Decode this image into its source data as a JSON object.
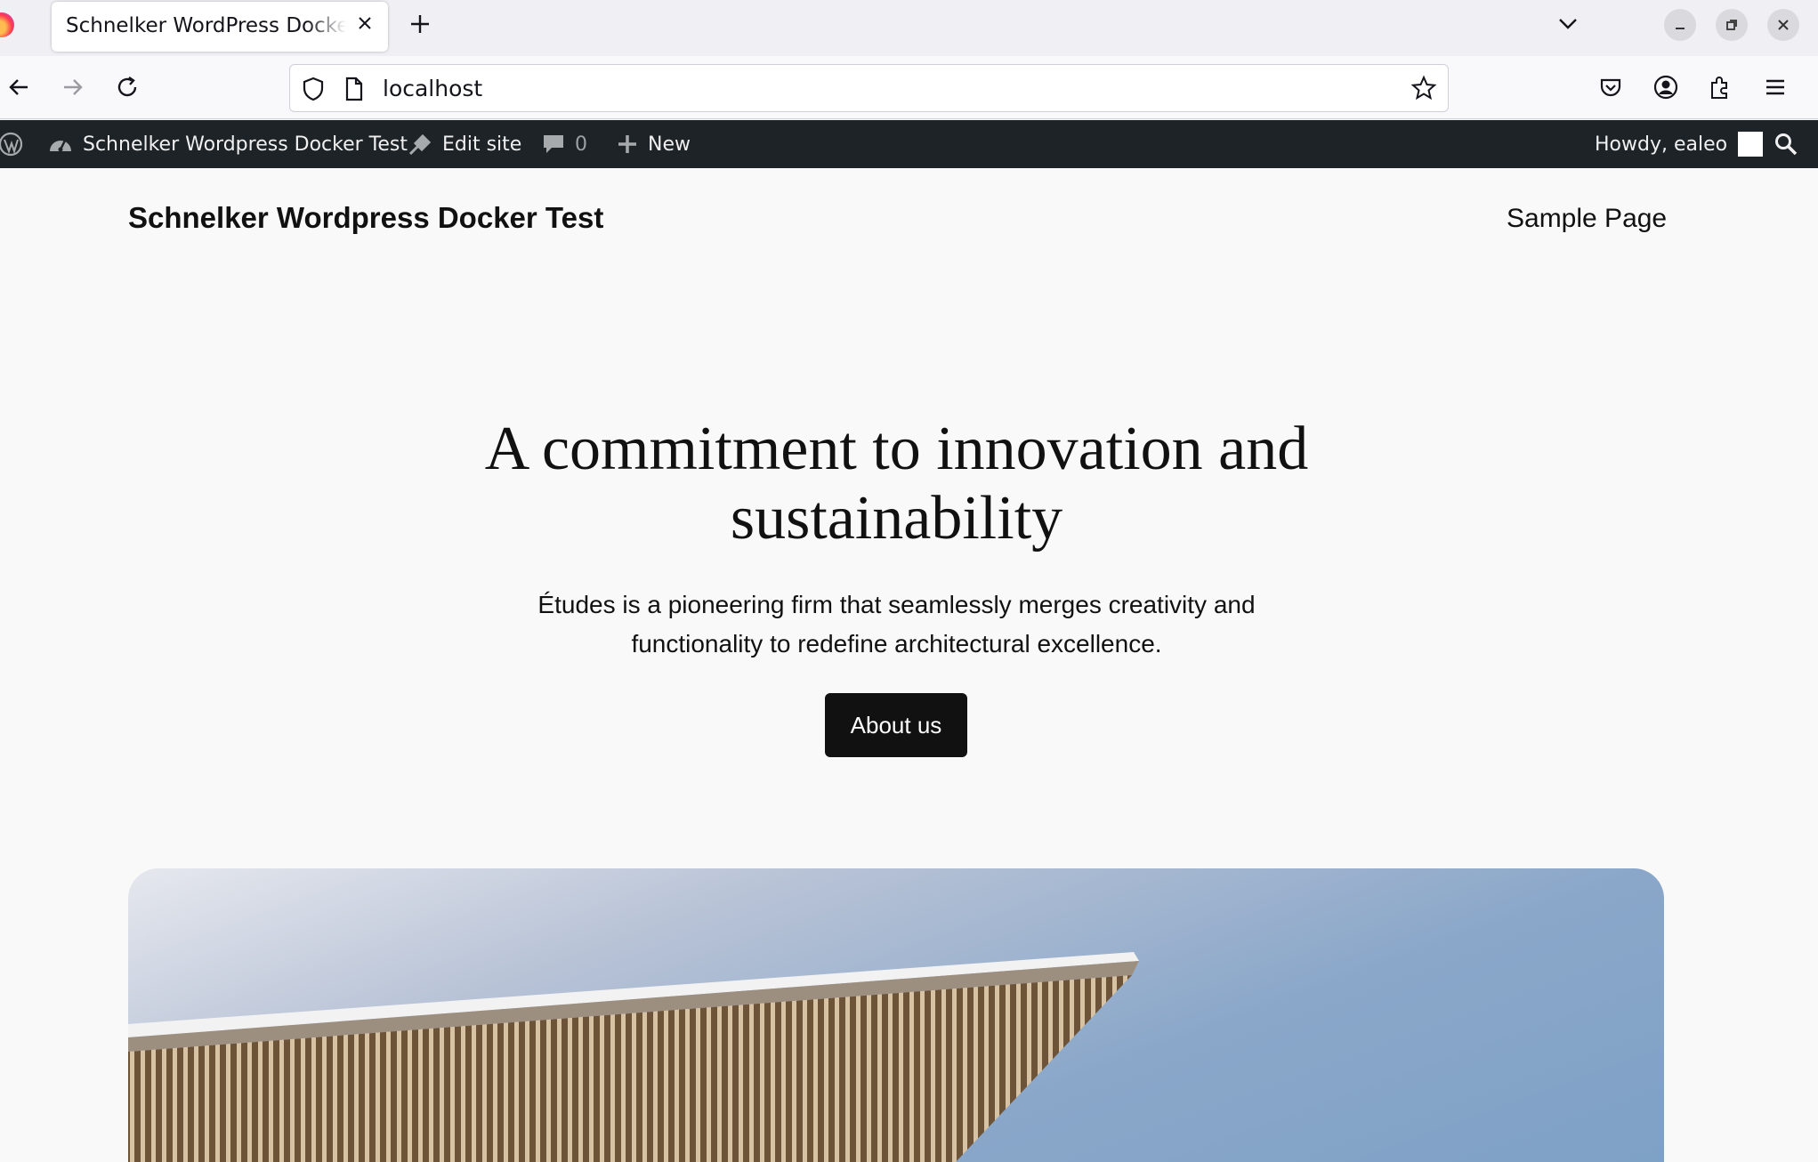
{
  "browser": {
    "tab_title": "Schnelker WordPress Docker",
    "url": "localhost"
  },
  "admin_bar": {
    "site_name": "Schnelker Wordpress Docker Test",
    "edit_site": "Edit site",
    "comments_count": "0",
    "new_label": "New",
    "greeting": "Howdy, ealeo"
  },
  "header": {
    "site_title": "Schnelker Wordpress Docker Test",
    "nav_sample_page": "Sample Page"
  },
  "hero": {
    "heading_line1": "A commitment to innovation and",
    "heading_line2": "sustainability",
    "text_line1": "Études is a pioneering firm that seamlessly merges creativity and",
    "text_line2": "functionality to redefine architectural excellence.",
    "button_label": "About us"
  },
  "colors": {
    "admin_bar_bg": "#1d2327",
    "page_bg": "#f9f9f9",
    "button_bg": "#111111"
  }
}
